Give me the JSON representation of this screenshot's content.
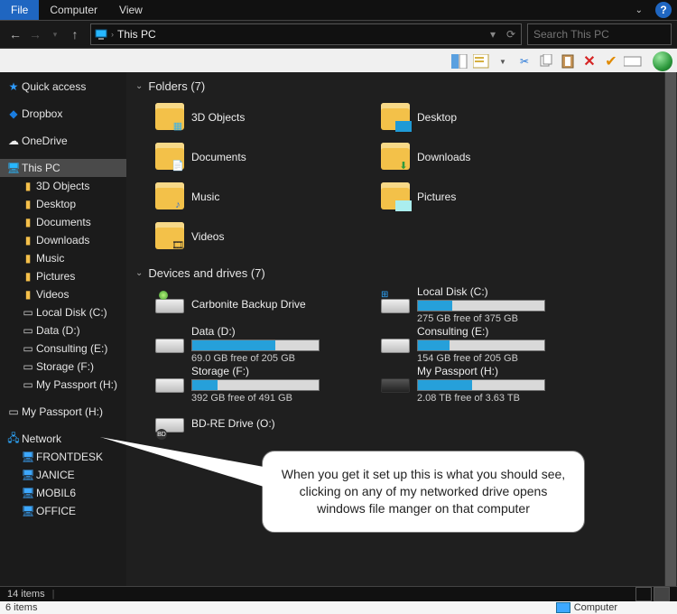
{
  "menubar": {
    "file": "File",
    "computer": "Computer",
    "view": "View"
  },
  "breadcrumb": {
    "location": "This PC"
  },
  "search": {
    "placeholder": "Search This PC"
  },
  "sidebar": {
    "quickaccess": "Quick access",
    "dropbox": "Dropbox",
    "onedrive": "OneDrive",
    "thispc": "This PC",
    "thispc_children": [
      {
        "label": "3D Objects"
      },
      {
        "label": "Desktop"
      },
      {
        "label": "Documents"
      },
      {
        "label": "Downloads"
      },
      {
        "label": "Music"
      },
      {
        "label": "Pictures"
      },
      {
        "label": "Videos"
      },
      {
        "label": "Local Disk (C:)"
      },
      {
        "label": "Data (D:)"
      },
      {
        "label": "Consulting (E:)"
      },
      {
        "label": "Storage (F:)"
      },
      {
        "label": "My Passport (H:)"
      }
    ],
    "mypassport": "My Passport (H:)",
    "network": "Network",
    "network_children": [
      {
        "label": "FRONTDESK"
      },
      {
        "label": "JANICE"
      },
      {
        "label": "MOBIL6"
      },
      {
        "label": "OFFICE"
      }
    ]
  },
  "content": {
    "folders_header": "Folders (7)",
    "folders": [
      {
        "label": "3D Objects"
      },
      {
        "label": "Desktop"
      },
      {
        "label": "Documents"
      },
      {
        "label": "Downloads"
      },
      {
        "label": "Music"
      },
      {
        "label": "Pictures"
      },
      {
        "label": "Videos"
      }
    ],
    "drives_header": "Devices and drives (7)",
    "drives": [
      {
        "label": "Carbonite Backup Drive",
        "free": "",
        "bar": null
      },
      {
        "label": "Local Disk (C:)",
        "free": "275 GB free of 375 GB",
        "bar": 27
      },
      {
        "label": "Data (D:)",
        "free": "69.0 GB free of 205 GB",
        "bar": 66
      },
      {
        "label": "Consulting (E:)",
        "free": "154 GB free of 205 GB",
        "bar": 25
      },
      {
        "label": "Storage (F:)",
        "free": "392 GB free of 491 GB",
        "bar": 20
      },
      {
        "label": "My Passport (H:)",
        "free": "2.08 TB free of 3.63 TB",
        "bar": 43
      },
      {
        "label": "BD-RE Drive (O:)",
        "free": "",
        "bar": null
      }
    ]
  },
  "status": {
    "items": "14 items"
  },
  "bottom": {
    "items": "6 items",
    "computer": "Computer"
  },
  "callout": "When you get it set up this is what you should see, clicking on any of my networked drive opens windows file manger on that computer"
}
